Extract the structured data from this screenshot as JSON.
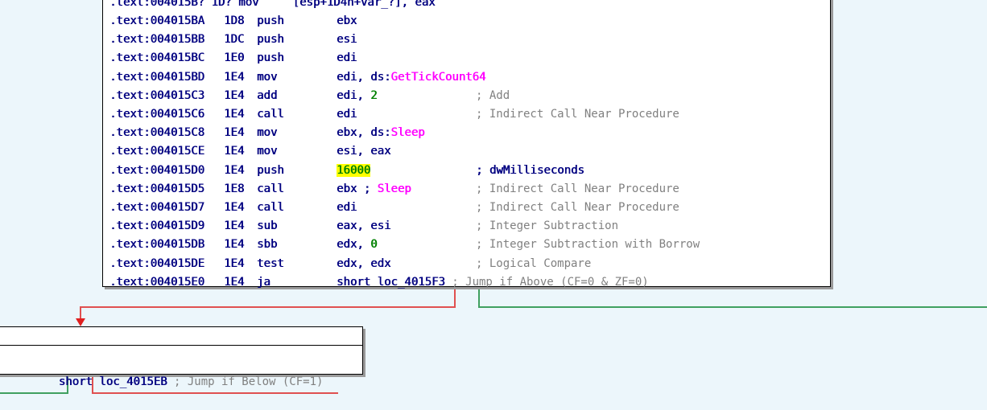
{
  "colors": {
    "background": "#ecf6fb",
    "address": "#000080",
    "api_name": "#ff00ff",
    "number": "#008000",
    "comment": "#808080",
    "highlight": "#ffff00",
    "edge_false": "#e05050",
    "edge_true": "#40a060"
  },
  "main_node": {
    "partial_top_row": ".text:004015B? 1D? mov     [esp+1D4h+var_?], eax",
    "rows": [
      {
        "addr": ".text:004015BA",
        "sp": "1D8",
        "mnem": "push",
        "op1": "ebx",
        "op1_api": "",
        "op_suffix": "",
        "comment": ""
      },
      {
        "addr": ".text:004015BB",
        "sp": "1DC",
        "mnem": "push",
        "op1": "esi",
        "op1_api": "",
        "op_suffix": "",
        "comment": ""
      },
      {
        "addr": ".text:004015BC",
        "sp": "1E0",
        "mnem": "push",
        "op1": "edi",
        "op1_api": "",
        "op_suffix": "",
        "comment": ""
      },
      {
        "addr": ".text:004015BD",
        "sp": "1E4",
        "mnem": "mov",
        "op1": "edi, ds:",
        "op1_api": "GetTickCount64",
        "op_suffix": "",
        "comment": ""
      },
      {
        "addr": ".text:004015C3",
        "sp": "1E4",
        "mnem": "add",
        "op1": "edi, ",
        "op1_api": "",
        "op_num": "2",
        "op_suffix": "",
        "comment": "; Add"
      },
      {
        "addr": ".text:004015C6",
        "sp": "1E4",
        "mnem": "call",
        "op1": "edi",
        "op1_api": "",
        "op_suffix": "",
        "comment": "; Indirect Call Near Procedure"
      },
      {
        "addr": ".text:004015C8",
        "sp": "1E4",
        "mnem": "mov",
        "op1": "ebx, ds:",
        "op1_api": "Sleep",
        "op_suffix": "",
        "comment": ""
      },
      {
        "addr": ".text:004015CE",
        "sp": "1E4",
        "mnem": "mov",
        "op1": "esi, eax",
        "op1_api": "",
        "op_suffix": "",
        "comment": ""
      },
      {
        "addr": ".text:004015D0",
        "sp": "1E4",
        "mnem": "push",
        "op1": "",
        "op1_api": "",
        "op_hl": "16000",
        "op_suffix": "",
        "comment": "; dwMilliseconds",
        "comment_dark": true
      },
      {
        "addr": ".text:004015D5",
        "sp": "1E8",
        "mnem": "call",
        "op1": "ebx ; ",
        "op1_api": "Sleep",
        "op_suffix": "",
        "comment": "; Indirect Call Near Procedure"
      },
      {
        "addr": ".text:004015D7",
        "sp": "1E4",
        "mnem": "call",
        "op1": "edi",
        "op1_api": "",
        "op_suffix": "",
        "comment": "; Indirect Call Near Procedure"
      },
      {
        "addr": ".text:004015D9",
        "sp": "1E4",
        "mnem": "sub",
        "op1": "eax, esi",
        "op1_api": "",
        "op_suffix": "",
        "comment": "; Integer Subtraction"
      },
      {
        "addr": ".text:004015DB",
        "sp": "1E4",
        "mnem": "sbb",
        "op1": "edx, ",
        "op1_api": "",
        "op_num": "0",
        "op_suffix": "",
        "comment": "; Integer Subtraction with Borrow"
      },
      {
        "addr": ".text:004015DE",
        "sp": "1E4",
        "mnem": "test",
        "op1": "edx, edx",
        "op1_api": "",
        "op_suffix": "",
        "comment": "; Logical Compare"
      },
      {
        "addr": ".text:004015E0",
        "sp": "1E4",
        "mnem": "ja",
        "op1": "short loc_4015F3",
        "op1_api": "",
        "op_suffix": "",
        "comment": "; Jump if Above (CF=0 & ZF=0)",
        "inline_comment": true
      }
    ]
  },
  "branch_node": {
    "instruction": "short loc_4015EB",
    "comment": " ; Jump if Below (CF=1)"
  }
}
